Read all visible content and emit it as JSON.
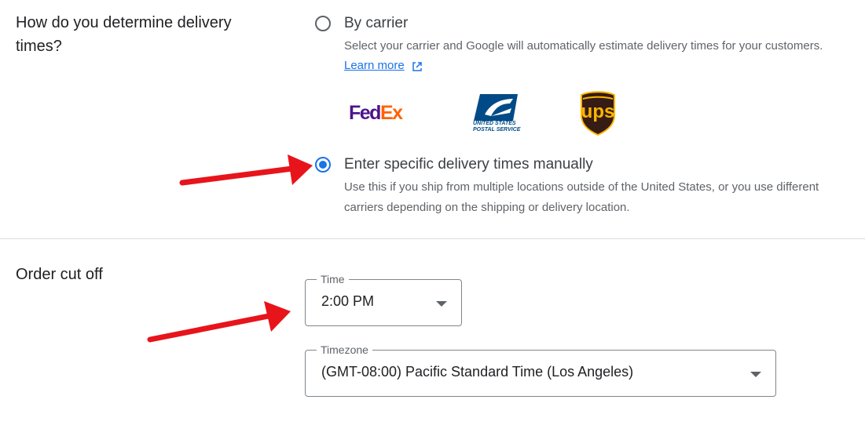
{
  "delivery": {
    "title": "How do you determine delivery times?",
    "options": [
      {
        "label": "By carrier",
        "description": "Select your carrier and Google will automatically estimate delivery times for your customers.",
        "link": "Learn more",
        "selected": false
      },
      {
        "label": "Enter specific delivery times manually",
        "description": "Use this if you ship from multiple locations outside of the United States, or you use different carriers depending on the shipping or delivery location.",
        "selected": true
      }
    ],
    "carriers": {
      "fedex": {
        "fed": "Fed",
        "ex": "Ex"
      },
      "usps": {
        "line1": "UNITED STATES",
        "line2": "POSTAL SERVICE"
      },
      "ups": {
        "text": "ups"
      }
    }
  },
  "cutoff": {
    "title": "Order cut off",
    "time": {
      "label": "Time",
      "value": "2:00 PM"
    },
    "timezone": {
      "label": "Timezone",
      "value": "(GMT-08:00) Pacific Standard Time (Los Angeles)"
    }
  },
  "colors": {
    "accent": "#1a73e8",
    "annotation_arrow": "#e8141b",
    "fedex_purple": "#4d148c",
    "fedex_orange": "#ff6200",
    "usps_blue": "#004b87",
    "ups_brown": "#351c15",
    "ups_gold": "#ffb500"
  }
}
